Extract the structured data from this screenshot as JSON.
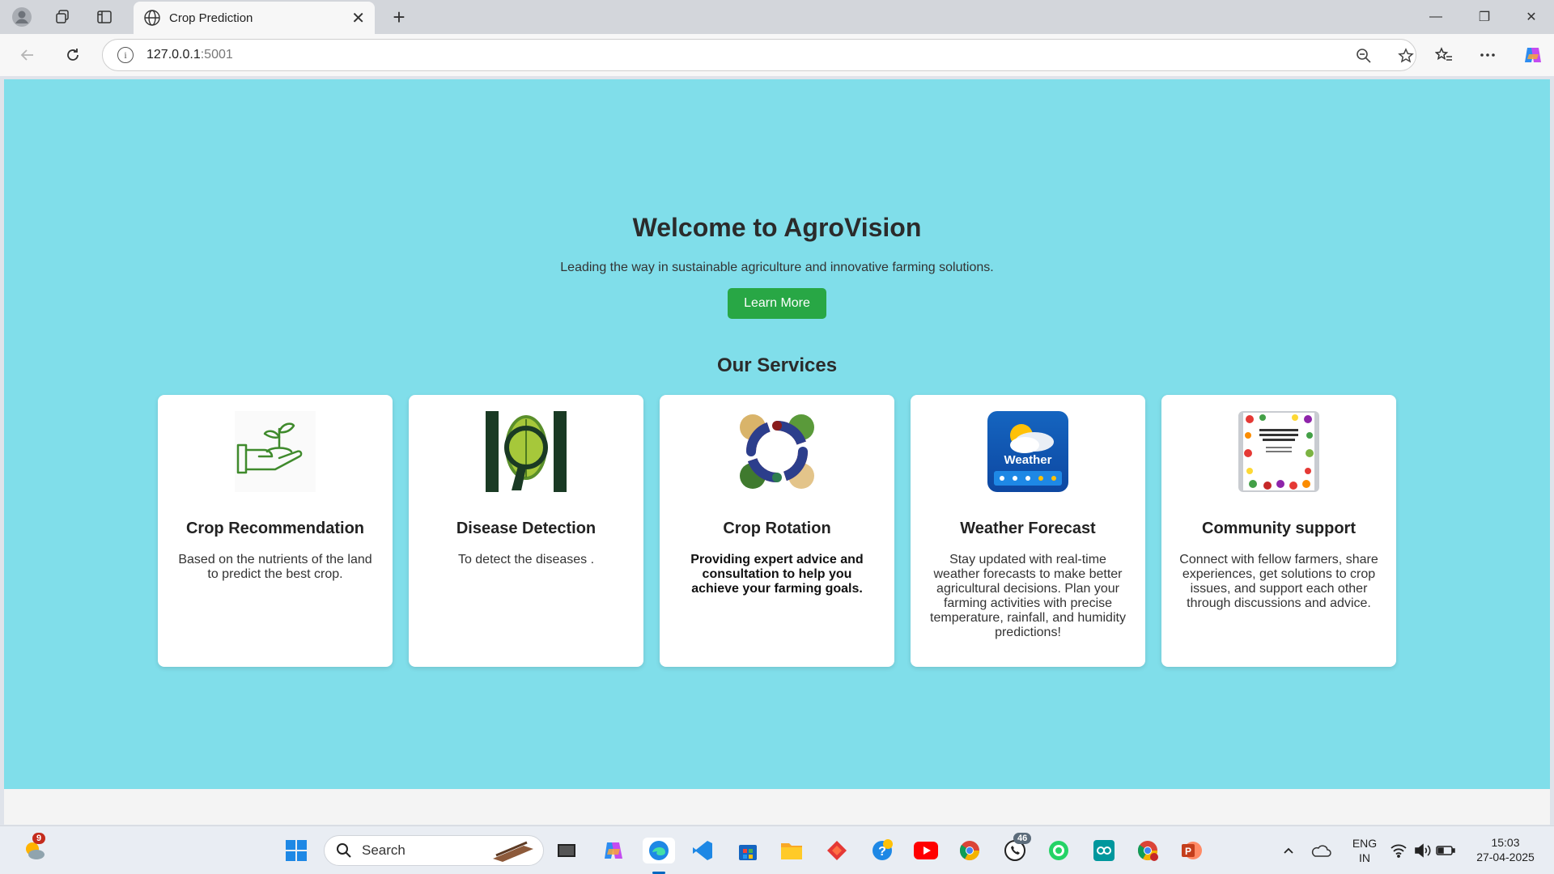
{
  "browser": {
    "tab_title": "Crop Prediction",
    "tab_close": "✕",
    "new_tab": "+",
    "url_host": "127.0.0.1",
    "url_port": ":5001",
    "controls": {
      "minimize": "—",
      "restore": "❐",
      "close": "✕"
    }
  },
  "page": {
    "hero_title": "Welcome to AgroVision",
    "hero_subtitle": "Leading the way in sustainable agriculture and innovative farming solutions.",
    "learn_more": "Learn More",
    "services_title": "Our Services",
    "accent_color": "#28a745",
    "background_color": "#80deea",
    "services": [
      {
        "title": "Crop Recommendation",
        "description": "Based on the nutrients of the land to predict the best crop.",
        "icon": "hand-plant-icon"
      },
      {
        "title": "Disease Detection",
        "description": "To detect the diseases .",
        "icon": "leaf-magnifier-icon"
      },
      {
        "title": "Crop Rotation",
        "description": "Providing expert advice and consultation to help you achieve your farming goals.",
        "icon": "crop-rotation-cycle-icon"
      },
      {
        "title": "Weather Forecast",
        "description": "Stay updated with real-time weather forecasts to make better agricultural decisions. Plan your farming activities with precise temperature, rainfall, and humidity predictions!",
        "icon": "weather-app-icon",
        "image_text": "Weather"
      },
      {
        "title": "Community support",
        "description": "Connect with fellow farmers, share experiences, get solutions to crop issues, and support each other through discussions and advice.",
        "icon": "vegetables-poster-icon"
      }
    ]
  },
  "taskbar": {
    "search_label": "Search",
    "weather_badge": "9",
    "whatsapp_badge": "46",
    "lang_primary": "ENG",
    "lang_secondary": "IN",
    "time": "15:03",
    "date": "27-04-2025"
  }
}
